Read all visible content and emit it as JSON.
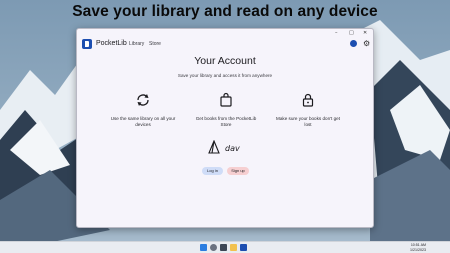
{
  "banner": "Save your library and read on any device",
  "app": {
    "name": "PocketLib",
    "nav": [
      "Library",
      "Store"
    ],
    "window_controls": [
      "–",
      "□",
      "✕"
    ]
  },
  "main": {
    "title": "Your Account",
    "subtitle": "Save your library and access it from anywhere",
    "features": [
      {
        "icon": "sync-icon",
        "text": "Use the same library on all your devices"
      },
      {
        "icon": "shopping-bag-icon",
        "text": "Get books from the PocketLib Store"
      },
      {
        "icon": "lock-icon",
        "text": "Make sure your books don't get lost"
      }
    ],
    "brand": "dav",
    "login_label": "Log in",
    "signup_label": "Sign up"
  },
  "taskbar": {
    "time": "10:51 AM",
    "date": "1/21/2023"
  },
  "colors": {
    "accent": "#1c4eb0",
    "login_bg": "#cfdcf7",
    "signup_bg": "#f6cfd1",
    "window_bg": "#f6f4fb"
  }
}
